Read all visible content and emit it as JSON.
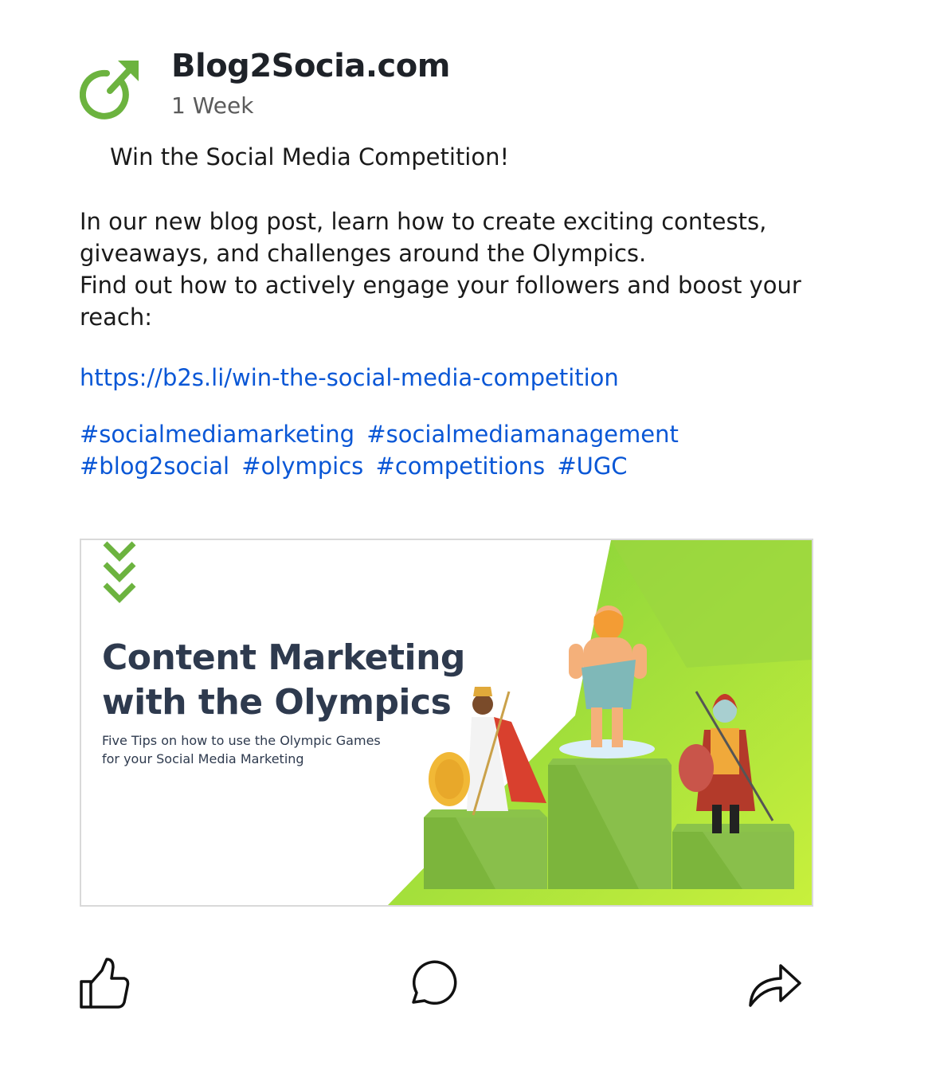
{
  "post": {
    "author": "Blog2Socia.com",
    "time": "1 Week",
    "avatar_icon": "share-arrow-circle-icon",
    "brand_color": "#6cb33f",
    "headline": "Win the Social Media Competition!",
    "body": [
      "In our new blog post, learn how to create exciting contests, giveaways, and challenges around the Olympics.",
      "Find out how to actively engage your followers and boost your reach:"
    ],
    "link": "https://b2s.li/win-the-social-media-competition",
    "link_color": "#0a57d6",
    "hashtags": [
      "#socialmediamarketing",
      "#socialmediamanagement",
      "#blog2social",
      "#olympics",
      "#competitions",
      "#UGC"
    ]
  },
  "image": {
    "title_line1": "Content Marketing",
    "title_line2": "with the Olympics",
    "subtitle_line1": "Five Tips on how to use the Olympic Games",
    "subtitle_line2": "for your Social Media Marketing",
    "accent_color": "#8fd63a"
  },
  "actions": {
    "like_icon": "thumbs-up-icon",
    "comment_icon": "comment-bubble-icon",
    "share_icon": "share-arrow-icon"
  }
}
